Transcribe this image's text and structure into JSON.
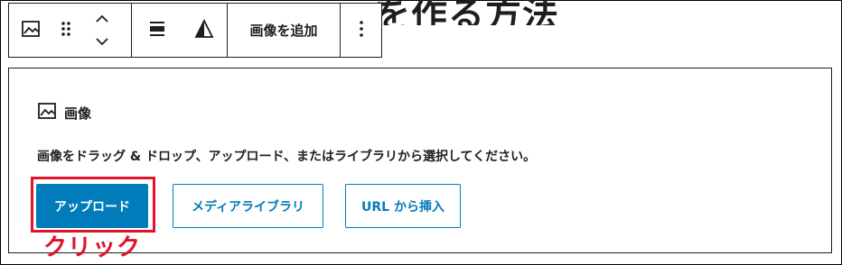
{
  "heading": {
    "text": "を作る方法"
  },
  "toolbar": {
    "add_image_label": "画像を追加",
    "icons": [
      "image-icon",
      "drag-handle-icon",
      "move-up-icon",
      "move-down-icon",
      "align-icon",
      "duotone-icon",
      "more-options-icon"
    ]
  },
  "placeholder": {
    "title": "画像",
    "instructions": "画像をドラッグ & ドロップ、アップロード、またはライブラリから選択してください。",
    "upload_label": "アップロード",
    "media_library_label": "メディアライブラリ",
    "insert_url_label": "URL から挿入"
  },
  "annotation": {
    "text": "クリック",
    "color": "#e0152a"
  },
  "colors": {
    "accent": "#007cba",
    "highlight": "#e0152a",
    "text": "#1e1e1e"
  }
}
